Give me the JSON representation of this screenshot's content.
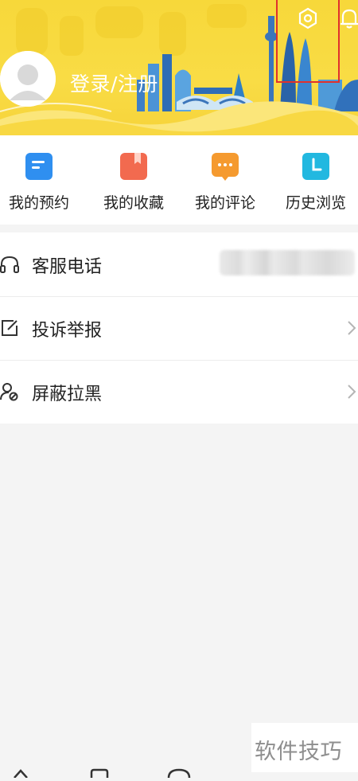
{
  "header": {
    "login_label": "登录/注册",
    "accent_color": "#f7d83a",
    "highlight_color": "#e0312d",
    "icons": [
      "avatar-icon",
      "settings-icon",
      "bell-icon"
    ]
  },
  "quick_actions": [
    {
      "label": "我的预约",
      "icon": "appointment-icon",
      "color": "#2f8ff0"
    },
    {
      "label": "我的收藏",
      "icon": "favorite-icon",
      "color": "#f26a4f"
    },
    {
      "label": "我的评论",
      "icon": "comment-icon",
      "color": "#f59a2f"
    },
    {
      "label": "历史浏览",
      "icon": "history-icon",
      "color": "#22b8e0"
    }
  ],
  "menu": [
    {
      "label": "客服电话",
      "icon": "headset-icon",
      "value_blurred": true
    },
    {
      "label": "投诉举报",
      "icon": "report-icon"
    },
    {
      "label": "屏蔽拉黑",
      "icon": "block-user-icon"
    }
  ],
  "watermark": {
    "text": "软件技巧"
  }
}
